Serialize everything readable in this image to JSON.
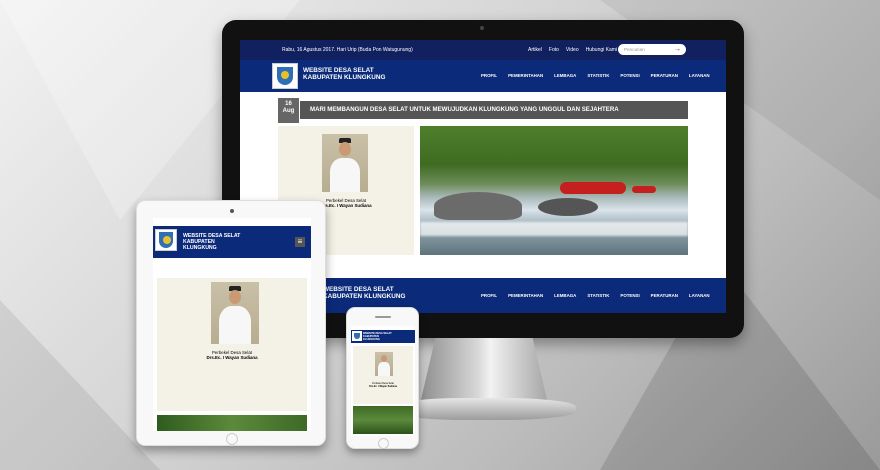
{
  "colors": {
    "topbar": "#11205f",
    "navbar": "#0b2a7a",
    "headline_bg": "#555555",
    "card_bg": "#f4f1e6"
  },
  "topbar": {
    "date_text": "Rabu, 16 Agustus 2017. Hari Urip (Buda Pon Watugunung)",
    "links": [
      "Artikel",
      "Foto",
      "Video",
      "Hubungi Kami"
    ],
    "search_placeholder": "Pencarian",
    "search_icon": "arrow-right-icon"
  },
  "navbar": {
    "brand_line1": "WEBSITE DESA SELAT",
    "brand_line2": "KABUPATEN KLUNGKUNG",
    "menu": [
      "PROFIL",
      "PEMERINTAHAN",
      "LEMBAGA",
      "STATISTIK",
      "POTENSI",
      "PERATURAN",
      "LAYANAN"
    ]
  },
  "post": {
    "day": "16",
    "month": "Aug",
    "headline": "MARI MEMBANGUN DESA SELAT UNTUK MEWUJUDKAN KLUNGKUNG YANG UNGGUL DAN SEJAHTERA"
  },
  "profile": {
    "title": "Perbekel Desa Selat",
    "name": "Drs.Ec. I Wayan Sudiana"
  },
  "footer": {
    "brand_line1": "WEBSITE DESA SELAT",
    "brand_line2": "KABUPATEN KLUNGKUNG"
  },
  "tablet": {
    "brand_line1": "WEBSITE DESA SELAT",
    "brand_line2": "KABUPATEN",
    "brand_line3": "KLUNGKUNG",
    "menu_icon": "hamburger-icon"
  },
  "phone": {
    "brand_line1": "WEBSITE DESA SELAT",
    "brand_line2": "KABUPATEN",
    "brand_line3": "KLUNGKUNG"
  }
}
